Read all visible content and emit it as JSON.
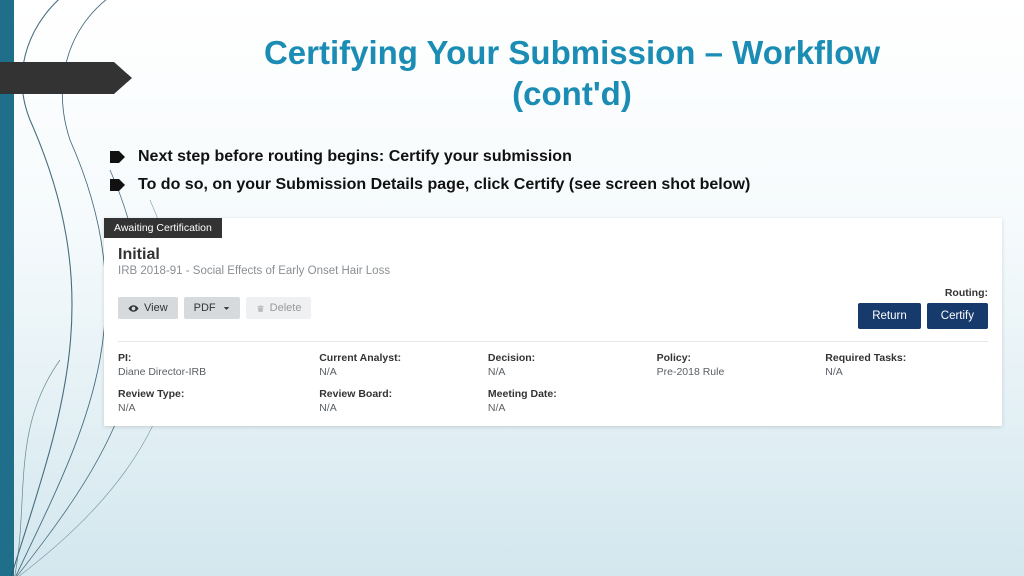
{
  "title_line1": "Certifying Your Submission – Workflow",
  "title_line2": "(cont'd)",
  "bullets": [
    "Next step before routing begins: Certify your submission",
    "To do so, on your Submission Details page, click Certify (see screen shot below)"
  ],
  "panel": {
    "status": "Awaiting Certification",
    "sub_title": "Initial",
    "sub_desc": "IRB 2018-91 - Social Effects of Early Onset Hair Loss",
    "toolbar": {
      "view": "View",
      "pdf": "PDF",
      "delete": "Delete"
    },
    "routing_label": "Routing:",
    "routing": {
      "return": "Return",
      "certify": "Certify"
    },
    "meta": [
      {
        "k": "PI:",
        "v": "Diane Director-IRB"
      },
      {
        "k": "Current Analyst:",
        "v": "N/A"
      },
      {
        "k": "Decision:",
        "v": "N/A"
      },
      {
        "k": "Policy:",
        "v": "Pre-2018 Rule"
      },
      {
        "k": "Required Tasks:",
        "v": "N/A"
      },
      {
        "k": "Review Type:",
        "v": "N/A"
      },
      {
        "k": "Review Board:",
        "v": "N/A"
      },
      {
        "k": "Meeting Date:",
        "v": "N/A"
      },
      {
        "k": "",
        "v": ""
      },
      {
        "k": "",
        "v": ""
      }
    ]
  }
}
